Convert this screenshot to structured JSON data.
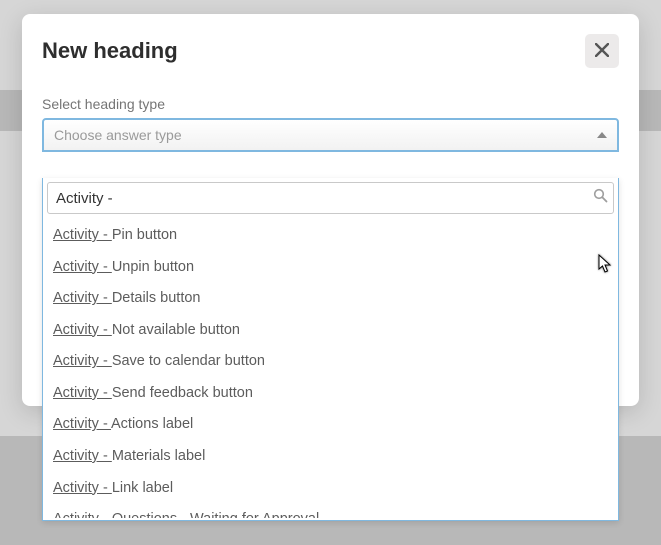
{
  "modal": {
    "title": "New heading",
    "close_label": "Close"
  },
  "field": {
    "label": "Select heading type",
    "placeholder": "Choose answer type"
  },
  "search": {
    "value": "Activity -"
  },
  "match_prefix": "Activity - ",
  "options": [
    {
      "rest": "Pin button"
    },
    {
      "rest": "Unpin button"
    },
    {
      "rest": "Details button"
    },
    {
      "rest": "Not available button"
    },
    {
      "rest": "Save to calendar button"
    },
    {
      "rest": "Send feedback button"
    },
    {
      "rest": "Actions label"
    },
    {
      "rest": "Materials label"
    },
    {
      "rest": "Link label"
    },
    {
      "rest": "Questions - Waiting for Approval"
    }
  ]
}
